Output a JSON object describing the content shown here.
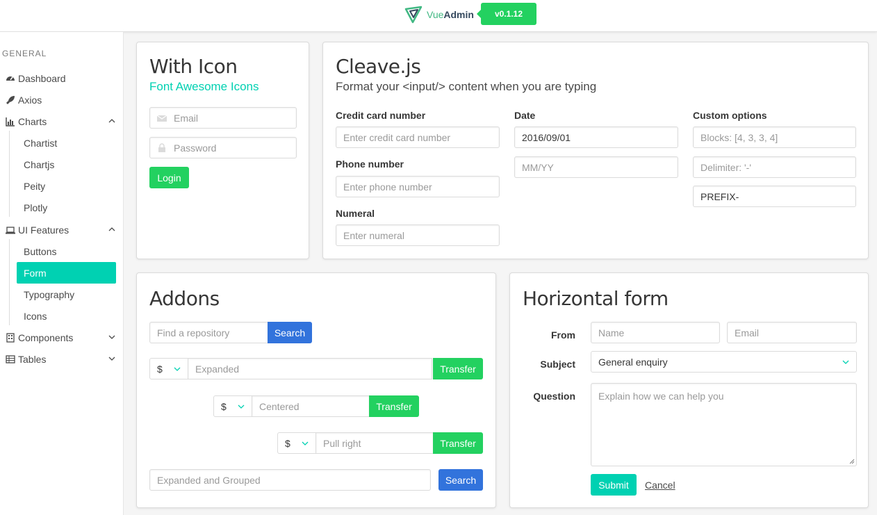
{
  "brand": {
    "name_part1": "Vue",
    "name_part2": "Admin",
    "version": "v0.1.12"
  },
  "sidebar": {
    "section": "GENERAL",
    "items": [
      {
        "label": "Dashboard",
        "icon": "tachometer-icon"
      },
      {
        "label": "Axios",
        "icon": "rocket-icon"
      },
      {
        "label": "Charts",
        "icon": "bar-chart-icon",
        "expanded": true,
        "children": [
          "Chartist",
          "Chartjs",
          "Peity",
          "Plotly"
        ]
      },
      {
        "label": "UI Features",
        "icon": "laptop-icon",
        "expanded": true,
        "children": [
          "Buttons",
          "Form",
          "Typography",
          "Icons"
        ],
        "active_child": "Form"
      },
      {
        "label": "Components",
        "icon": "building-icon",
        "expanded": false
      },
      {
        "label": "Tables",
        "icon": "table-icon",
        "expanded": false
      }
    ]
  },
  "with_icon": {
    "title": "With Icon",
    "subtitle": "Font Awesome Icons",
    "email_placeholder": "Email",
    "password_placeholder": "Password",
    "login_label": "Login"
  },
  "cleave": {
    "title": "Cleave.js",
    "subtitle": "Format your <input/> content when you are typing",
    "credit_label": "Credit card number",
    "credit_placeholder": "Enter credit card number",
    "phone_label": "Phone number",
    "phone_placeholder": "Enter phone number",
    "numeral_label": "Numeral",
    "numeral_placeholder": "Enter numeral",
    "date_label": "Date",
    "date_value": "2016/09/01",
    "date2_placeholder": "MM/YY",
    "custom_label": "Custom options",
    "blocks_placeholder": "Blocks: [4, 3, 3, 4]",
    "delimiter_placeholder": "Delimiter: '-'",
    "prefix_value": "PREFIX-"
  },
  "addons": {
    "title": "Addons",
    "repo_placeholder": "Find a repository",
    "search_label": "Search",
    "currency": "$",
    "expanded_placeholder": "Expanded",
    "centered_placeholder": "Centered",
    "pullright_placeholder": "Pull right",
    "transfer_label": "Transfer",
    "grouped_placeholder": "Expanded and Grouped",
    "search2_label": "Search"
  },
  "horizontal": {
    "title": "Horizontal form",
    "from_label": "From",
    "name_placeholder": "Name",
    "email_placeholder": "Email",
    "subject_label": "Subject",
    "subject_value": "General enquiry",
    "question_label": "Question",
    "question_placeholder": "Explain how we can help you",
    "submit_label": "Submit",
    "cancel_label": "Cancel"
  },
  "colors": {
    "primary": "#00d1b2",
    "success": "#23d160",
    "info": "#3273dc"
  }
}
